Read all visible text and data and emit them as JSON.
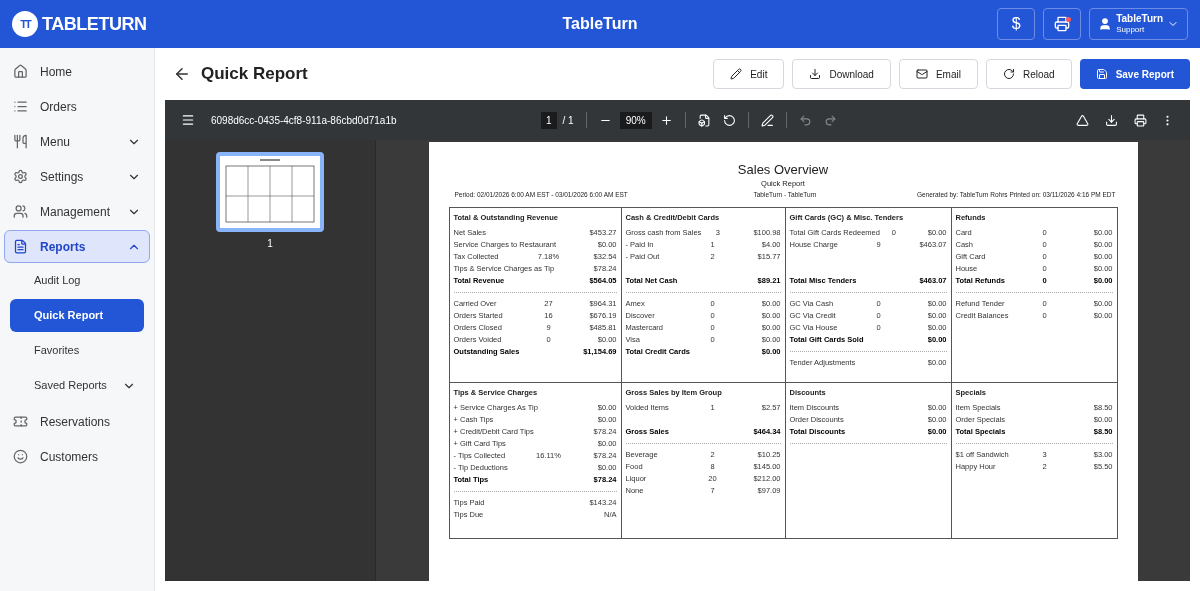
{
  "app": {
    "logo_mark": "TT",
    "logo_text": "TABLETURN",
    "title": "TableTurn",
    "currency_symbol": "$",
    "printer_alert": true,
    "user": {
      "name": "TableTurn",
      "role": "Support"
    }
  },
  "sidebar": {
    "items": [
      {
        "label": "Home",
        "selected": false
      },
      {
        "label": "Orders",
        "selected": false
      },
      {
        "label": "Menu",
        "selected": false,
        "expanded": false
      },
      {
        "label": "Settings",
        "selected": false,
        "expanded": false
      },
      {
        "label": "Management",
        "selected": false,
        "expanded": false
      },
      {
        "label": "Reports",
        "selected": true,
        "expanded": true,
        "children": [
          {
            "label": "Audit Log",
            "selected": false
          },
          {
            "label": "Quick Report",
            "selected": true
          },
          {
            "label": "Favorites",
            "selected": false
          },
          {
            "label": "Saved Reports",
            "selected": false,
            "expanded": false
          }
        ]
      },
      {
        "label": "Reservations",
        "selected": false
      },
      {
        "label": "Customers",
        "selected": false
      }
    ]
  },
  "page": {
    "title": "Quick Report",
    "buttons": [
      {
        "label": "Edit",
        "primary": false
      },
      {
        "label": "Download",
        "primary": false
      },
      {
        "label": "Email",
        "primary": false
      },
      {
        "label": "Reload",
        "primary": false
      },
      {
        "label": "Save Report",
        "primary": true
      }
    ]
  },
  "viewer": {
    "filename": "6098d6cc-0435-4cf8-911a-86cbd0d71a1b",
    "page": "1",
    "page_count": "/ 1",
    "zoom": "90%",
    "thumbnails": [
      {
        "label": "1",
        "selected": true
      }
    ]
  },
  "report": {
    "title": "Sales Overview",
    "subtitle": "Quick Report",
    "org": "TableTurn - TableTurn",
    "period": "Period: 02/01/2026 6:00 AM EST - 03/01/2026 6:00 AM EST",
    "generated": "Generated by: TableTurn Rohrs Printed on: 03/11/2026 4:16 PM EDT",
    "section_rows": [
      {
        "sections": [
          {
            "title": "Total & Outstanding Revenue",
            "rows": [
              {
                "kind": "line",
                "label": "Net Sales",
                "amount": "$453.27"
              },
              {
                "kind": "line",
                "label": "Service Charges to Restaurant",
                "amount": "$0.00"
              },
              {
                "kind": "line",
                "label": "Tax Collected",
                "count": "7.18%",
                "amount": "$32.54"
              },
              {
                "kind": "line",
                "label": "Tips & Service Charges as Tip",
                "amount": "$78.24"
              },
              {
                "kind": "total",
                "label": "Total Revenue",
                "amount": "$564.05"
              },
              {
                "kind": "divider"
              },
              {
                "kind": "line",
                "label": "Carried Over",
                "count": "27",
                "amount": "$964.31"
              },
              {
                "kind": "line",
                "label": "Orders Started",
                "count": "16",
                "amount": "$676.19"
              },
              {
                "kind": "line",
                "label": "Orders Closed",
                "count": "9",
                "amount": "$485.81"
              },
              {
                "kind": "line",
                "label": "Orders Voided",
                "count": "0",
                "amount": "$0.00"
              },
              {
                "kind": "total",
                "label": "Outstanding Sales",
                "amount": "$1,154.69"
              }
            ]
          },
          {
            "title": "Cash & Credit/Debit Cards",
            "rows": [
              {
                "kind": "line",
                "label": "Gross cash from Sales",
                "count": "3",
                "amount": "$100.98"
              },
              {
                "kind": "line",
                "label": "- Paid In",
                "count": "1",
                "amount": "$4.00"
              },
              {
                "kind": "line",
                "label": "- Paid Out",
                "count": "2",
                "amount": "$15.77"
              },
              {
                "kind": "gap"
              },
              {
                "kind": "total",
                "label": "Total Net Cash",
                "amount": "$89.21"
              },
              {
                "kind": "divider"
              },
              {
                "kind": "line",
                "label": "Amex",
                "count": "0",
                "amount": "$0.00"
              },
              {
                "kind": "line",
                "label": "Discover",
                "count": "0",
                "amount": "$0.00"
              },
              {
                "kind": "line",
                "label": "Mastercard",
                "count": "0",
                "amount": "$0.00"
              },
              {
                "kind": "line",
                "label": "Visa",
                "count": "0",
                "amount": "$0.00"
              },
              {
                "kind": "total",
                "label": "Total Credit Cards",
                "amount": "$0.00"
              }
            ]
          },
          {
            "title": "Gift Cards (GC) & Misc. Tenders",
            "rows": [
              {
                "kind": "line",
                "label": "Total Gift Cards Redeemed",
                "count": "0",
                "amount": "$0.00"
              },
              {
                "kind": "line",
                "label": "House Charge",
                "count": "9",
                "amount": "$463.07"
              },
              {
                "kind": "gap"
              },
              {
                "kind": "gap"
              },
              {
                "kind": "total",
                "label": "Total Misc Tenders",
                "amount": "$463.07"
              },
              {
                "kind": "divider"
              },
              {
                "kind": "line",
                "label": "GC Via Cash",
                "count": "0",
                "amount": "$0.00"
              },
              {
                "kind": "line",
                "label": "GC Via Credit",
                "count": "0",
                "amount": "$0.00"
              },
              {
                "kind": "line",
                "label": "GC Via House",
                "count": "0",
                "amount": "$0.00"
              },
              {
                "kind": "total",
                "label": "Total Gift Cards Sold",
                "amount": "$0.00"
              },
              {
                "kind": "divider"
              },
              {
                "kind": "line",
                "label": "Tender Adjustments",
                "amount": "$0.00"
              }
            ]
          },
          {
            "title": "Refunds",
            "rows": [
              {
                "kind": "line",
                "label": "Card",
                "count": "0",
                "amount": "$0.00"
              },
              {
                "kind": "line",
                "label": "Cash",
                "count": "0",
                "amount": "$0.00"
              },
              {
                "kind": "line",
                "label": "Gift Card",
                "count": "0",
                "amount": "$0.00"
              },
              {
                "kind": "line",
                "label": "House",
                "count": "0",
                "amount": "$0.00"
              },
              {
                "kind": "total",
                "label": "Total Refunds",
                "count": "0",
                "amount": "$0.00"
              },
              {
                "kind": "divider"
              },
              {
                "kind": "line",
                "label": "Refund Tender",
                "count": "0",
                "amount": "$0.00"
              },
              {
                "kind": "line",
                "label": "Credit Balances",
                "count": "0",
                "amount": "$0.00"
              }
            ]
          }
        ]
      },
      {
        "sections": [
          {
            "title": "Tips & Service Charges",
            "rows": [
              {
                "kind": "line",
                "label": "+ Service Charges As Tip",
                "amount": "$0.00"
              },
              {
                "kind": "line",
                "label": "+ Cash Tips",
                "amount": "$0.00"
              },
              {
                "kind": "line",
                "label": "+ Credit/Debit Card Tips",
                "amount": "$78.24"
              },
              {
                "kind": "line",
                "label": "+ Gift Card Tips",
                "amount": "$0.00"
              },
              {
                "kind": "line",
                "label": "- Tips Collected",
                "count": "16.11%",
                "amount": "$78.24"
              },
              {
                "kind": "line",
                "label": "- Tip Deductions",
                "amount": "$0.00"
              },
              {
                "kind": "total",
                "label": "Total Tips",
                "amount": "$78.24"
              },
              {
                "kind": "divider"
              },
              {
                "kind": "line",
                "label": "Tips Paid",
                "amount": "$143.24"
              },
              {
                "kind": "line",
                "label": "Tips Due",
                "amount": "N/A"
              }
            ]
          },
          {
            "title": "Gross Sales by Item Group",
            "rows": [
              {
                "kind": "line",
                "label": "Voided Items",
                "count": "1",
                "amount": "$2.57"
              },
              {
                "kind": "gap"
              },
              {
                "kind": "total",
                "label": "Gross Sales",
                "amount": "$464.34"
              },
              {
                "kind": "divider"
              },
              {
                "kind": "line",
                "label": "Beverage",
                "count": "2",
                "amount": "$10.25"
              },
              {
                "kind": "line",
                "label": "Food",
                "count": "8",
                "amount": "$145.00"
              },
              {
                "kind": "line",
                "label": "Liquor",
                "count": "20",
                "amount": "$212.00"
              },
              {
                "kind": "line",
                "label": "None",
                "count": "7",
                "amount": "$97.09"
              }
            ]
          },
          {
            "title": "Discounts",
            "rows": [
              {
                "kind": "line",
                "label": "Item Discounts",
                "amount": "$0.00"
              },
              {
                "kind": "line",
                "label": "Order Discounts",
                "amount": "$0.00"
              },
              {
                "kind": "total",
                "label": "Total Discounts",
                "amount": "$0.00"
              },
              {
                "kind": "divider"
              }
            ]
          },
          {
            "title": "Specials",
            "rows": [
              {
                "kind": "line",
                "label": "Item Specials",
                "amount": "$8.50"
              },
              {
                "kind": "line",
                "label": "Order Specials",
                "amount": "$0.00"
              },
              {
                "kind": "total",
                "label": "Total Specials",
                "amount": "$8.50"
              },
              {
                "kind": "divider"
              },
              {
                "kind": "line",
                "label": "$1 off Sandwich",
                "count": "3",
                "amount": "$3.00"
              },
              {
                "kind": "line",
                "label": "Happy Hour",
                "count": "2",
                "amount": "$5.50"
              }
            ]
          }
        ]
      }
    ]
  }
}
